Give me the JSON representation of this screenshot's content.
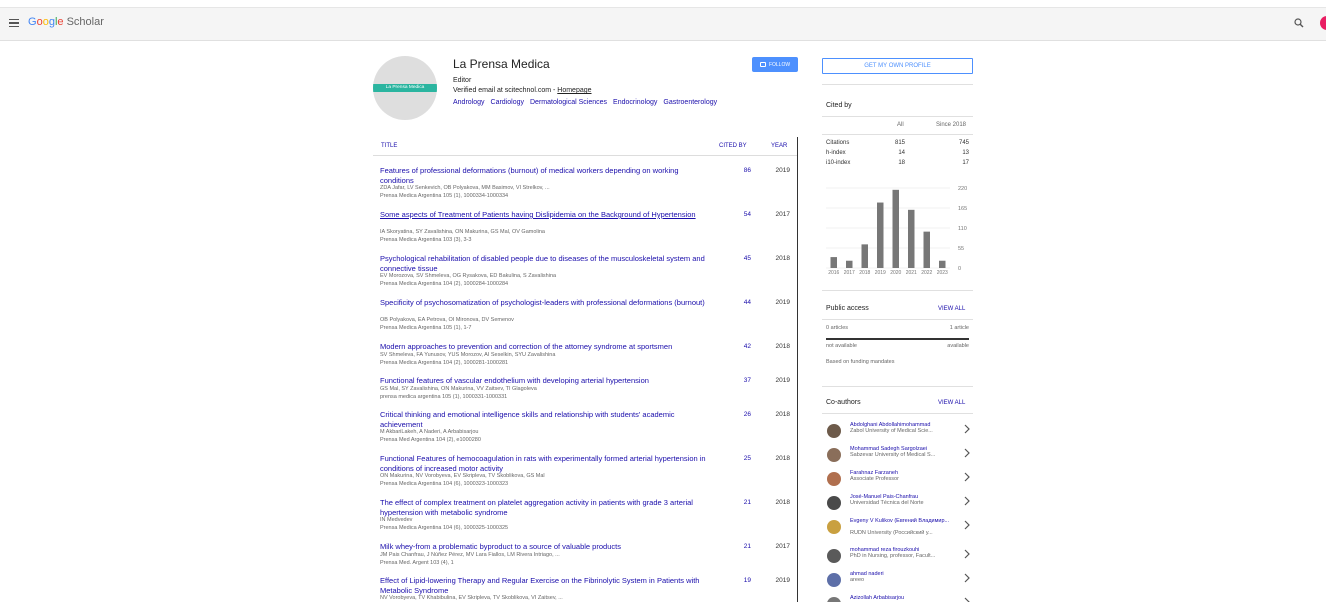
{
  "header": {
    "logo_letters": [
      "G",
      "o",
      "o",
      "g",
      "l",
      "e"
    ],
    "logo_word": "Scholar"
  },
  "profile": {
    "photo_label": "La Prensa Medica",
    "name": "La Prensa Medica",
    "role": "Editor",
    "email_text": "Verified email at scitechnol.com - ",
    "homepage": "Homepage",
    "tags": [
      "Andrology",
      "Cardiology",
      "Dermatological Sciences",
      "Endocrinology",
      "Gastroenterology"
    ],
    "follow_label": "FOLLOW"
  },
  "table": {
    "headers": {
      "title": "TITLE",
      "cited_by": "CITED BY",
      "year": "YEAR"
    },
    "rows": [
      {
        "title": "Features of professional deformations (burnout) of medical workers depending on working conditions",
        "authors": "ZDA Jafar, LV Senkevich, OB Polyakova, MM Basimov, VI Strelkov, ...",
        "venue": "Prensa Medica Argentina 105 (1), 1000334-1000334",
        "cited": "86",
        "year": "2019"
      },
      {
        "title": "Some aspects of Treatment of Patients having Dislipidemia on the Background of Hypertension",
        "authors": "IA Skoryatina, SY Zavalishina, ON Makurina, GS Mal, OV Gamolina",
        "venue": "Prensa Medica Argentina 103 (3), 3-3",
        "cited": "54",
        "year": "2017"
      },
      {
        "title": "Psychological rehabilitation of disabled people due to diseases of the musculoskeletal system and connective tissue",
        "authors": "EV Morozova, SV Shmeleva, OG Rysakova, ED Bakulina, S Zavalishina",
        "venue": "Prensa Medica Argentina 104 (2), 1000284-1000284",
        "cited": "45",
        "year": "2018"
      },
      {
        "title": "Specificity of psychosomatization of psychologist-leaders with professional deformations (burnout)",
        "authors": "OB Polyakova, EA Petrova, OI Mironova, DV Semenov",
        "venue": "Prensa Medica Argentina 105 (1), 1-7",
        "cited": "44",
        "year": "2019"
      },
      {
        "title": "Modern approaches to prevention and correction of the attorney syndrome at sportsmen",
        "authors": "SV Shmeleva, FA Yunusov, YUS Morozov, AI Seselkin, SYU Zavalishina",
        "venue": "Prensa Medica Argentina 104 (2), 1000281-1000281",
        "cited": "42",
        "year": "2018"
      },
      {
        "title": "Functional features of vascular endothelium with developing arterial hypertension",
        "authors": "GS Mal, SY Zavalishina, ON Makurina, VV Zaitsev, TI Glagoleva",
        "venue": "prensa medica argentina 105 (1), 1000331-1000331",
        "cited": "37",
        "year": "2019"
      },
      {
        "title": "Critical thinking and emotional intelligence skills and relationship with students' academic achievement",
        "authors": "M AkbariLakeh, A Naderi, A Arbabisarjou",
        "venue": "Prensa Med Argentina 104 (2), e1000280",
        "cited": "26",
        "year": "2018"
      },
      {
        "title": "Functional Features of hemocoagulation in rats with experimentally formed arterial hypertension in conditions of increased motor activity",
        "authors": "ON Makurina, NV Vorobyeva, EV Skripleva, TV Skoblikova, GS Mal",
        "venue": "Prensa Medica Argentina 104 (6), 1000323-1000323",
        "cited": "25",
        "year": "2018"
      },
      {
        "title": "The effect of complex treatment on platelet aggregation activity in patients with grade 3 arterial hypertension with metabolic syndrome",
        "authors": "IN Medvedev",
        "venue": "Prensa Medica Argentina 104 (6), 1000325-1000325",
        "cited": "21",
        "year": "2018"
      },
      {
        "title": "Milk whey-from a problematic byproduct to a source of valuable products",
        "authors": "JM Pais Chanfrau, J Núñez Pérez, MV Lara Fiallos, LM Rivera Intriago, ...",
        "venue": "Prensa Med. Argent 103 (4), 1",
        "cited": "21",
        "year": "2017"
      },
      {
        "title": "Effect of Lipid-lowering Therapy and Regular Exercise on the Fibrinolytic System in Patients with Metabolic Syndrome",
        "authors": "NV Vorobyeva, TV Khabibulina, EV Skripleva, TV Skoblikova, VI Zaitsev, ...",
        "venue": "",
        "cited": "19",
        "year": "2019"
      }
    ]
  },
  "sidebar": {
    "own_profile_label": "GET MY OWN PROFILE",
    "cited_by": {
      "title": "Cited by",
      "col_all": "All",
      "col_since": "Since 2018",
      "rows": [
        {
          "label": "Citations",
          "all": "815",
          "since": "745"
        },
        {
          "label": "h-index",
          "all": "14",
          "since": "13"
        },
        {
          "label": "i10-index",
          "all": "18",
          "since": "17"
        }
      ]
    },
    "public_access": {
      "title": "Public access",
      "view_all": "VIEW ALL",
      "left": "0 articles",
      "right": "1 article",
      "left_sub": "not available",
      "right_sub": "available",
      "note": "Based on funding mandates"
    },
    "coauthors": {
      "title": "Co-authors",
      "view_all": "VIEW ALL",
      "items": [
        {
          "name": "Abdolghani Abdollahimohammad",
          "affil": "Zabol University of Medical Scie..."
        },
        {
          "name": "Mohammad Sadegh Sargolzaei",
          "affil": "Sabzevar University of Medical S..."
        },
        {
          "name": "Farahnaz Farzaneh",
          "affil": "Associate Professor"
        },
        {
          "name": "José-Manuel Pais-Chanfrau",
          "affil": "Universidad Técnica del Norte"
        },
        {
          "name": "Evgeny V Kulikov (Евгений Владимир...",
          "affil": "RUDN University (Российский у..."
        },
        {
          "name": "mohammad reza firouzkouhi",
          "affil": "PhD in Nursing, professor, Facult..."
        },
        {
          "name": "ahmad naderi",
          "affil": "areeo"
        },
        {
          "name": "Azizollah Arbabisarjou",
          "affil": ""
        }
      ]
    }
  },
  "chart_data": {
    "type": "bar",
    "categories": [
      "2016",
      "2017",
      "2018",
      "2019",
      "2020",
      "2021",
      "2022",
      "2023"
    ],
    "values": [
      30,
      20,
      65,
      180,
      215,
      160,
      100,
      20
    ],
    "yticks": [
      "220",
      "165",
      "110",
      "55",
      "0"
    ],
    "ylim": [
      0,
      220
    ],
    "bar_color": "#777777"
  }
}
